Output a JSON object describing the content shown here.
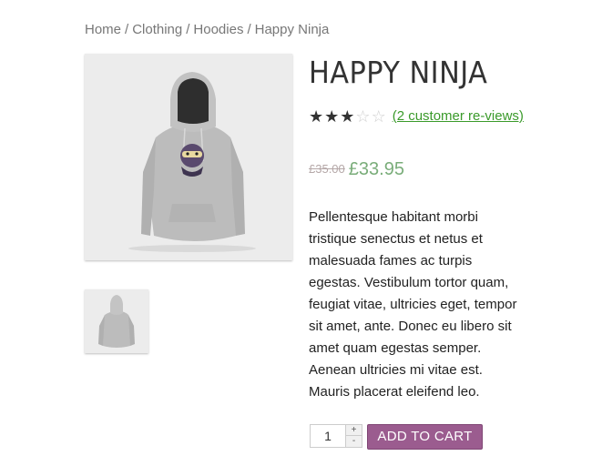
{
  "breadcrumb": {
    "items": [
      "Home",
      "Clothing",
      "Hoodies",
      "Happy Ninja"
    ],
    "separator": "/"
  },
  "product": {
    "title": "HAPPY NINJA",
    "rating": {
      "value": 3,
      "max": 5,
      "reviews_text": "(2 customer re-views)"
    },
    "price": {
      "old": "£35.00",
      "new": "£33.95"
    },
    "description": "Pellentesque habitant morbi tristique senectus et netus et malesuada fames ac turpis egestas. Vestibulum tortor quam, feugiat vitae, ultricies eget, tempor sit amet, ante. Donec eu libero sit amet quam egestas semper. Aenean ultricies mi vitae est. Mauris placerat eleifend leo.",
    "quantity": "1",
    "add_to_cart_label": "ADD TO CART"
  },
  "images": {
    "main": "hoodie-product-image",
    "thumb": "hoodie-back-thumbnail"
  },
  "colors": {
    "link": "#3a9a2a",
    "price": "#7aad7a",
    "button": "#9b5c8f"
  }
}
